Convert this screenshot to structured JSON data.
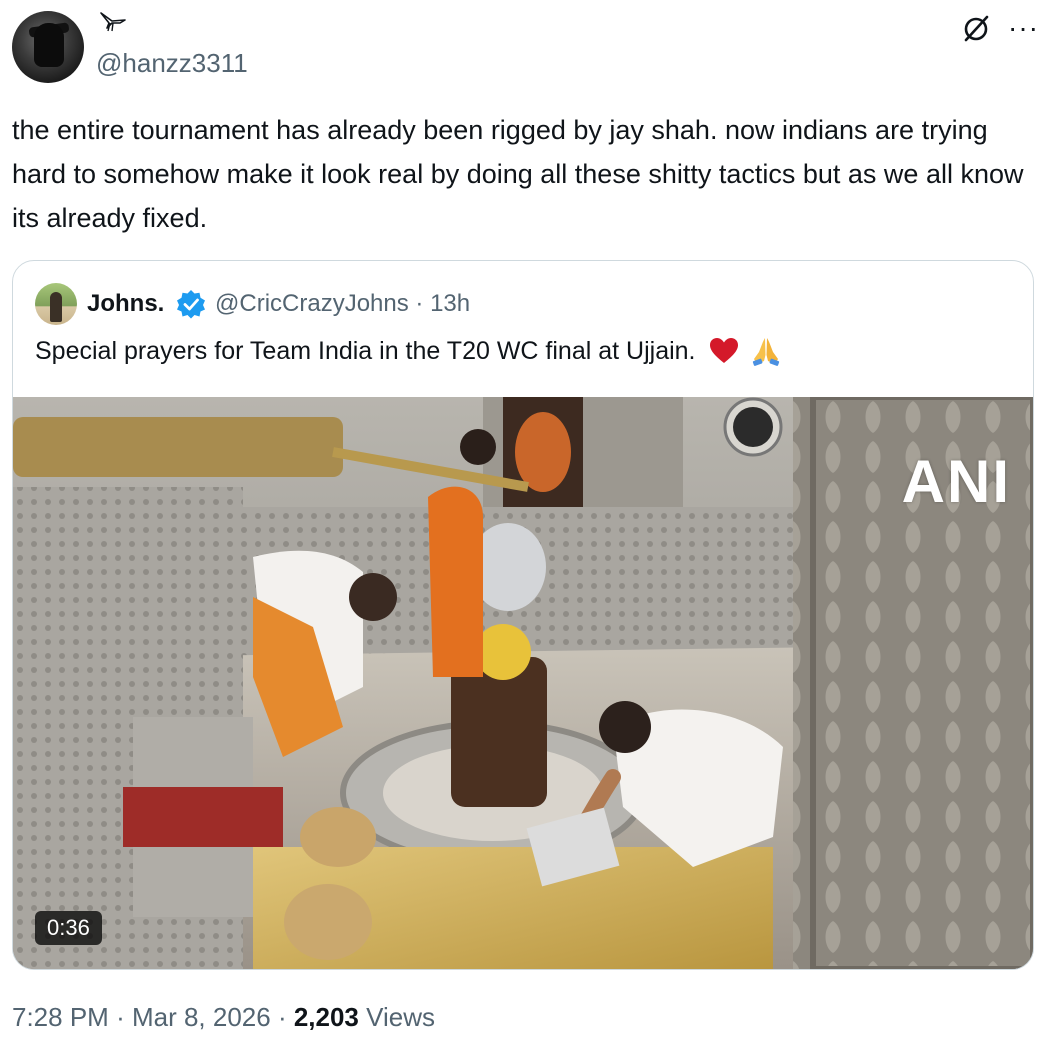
{
  "author": {
    "handle": "@hanzz3311",
    "avatar": "user-avatar",
    "badge": "bird-icon"
  },
  "tweet": {
    "text": "the entire tournament has already been rigged by jay shah. now indians are trying hard to somehow make it look real by doing all these shitty tactics but as we all know its already fixed."
  },
  "quote": {
    "name": "Johns.",
    "handle_time": "@CricCrazyJohns · 13h",
    "text": "Special prayers for Team India in the T20 WC final at Ujjain.",
    "emojis": [
      "red-heart-emoji",
      "folded-hands-emoji"
    ],
    "media": {
      "watermark": "ANI",
      "duration": "0:36"
    }
  },
  "meta": {
    "time": "7:28 PM",
    "date": "Mar 8, 2026",
    "views_count": "2,203",
    "views_label": "Views"
  },
  "colors": {
    "text": "#0f1419",
    "secondary": "#536471",
    "border": "#cfd9de",
    "verified": "#1d9bf0"
  }
}
